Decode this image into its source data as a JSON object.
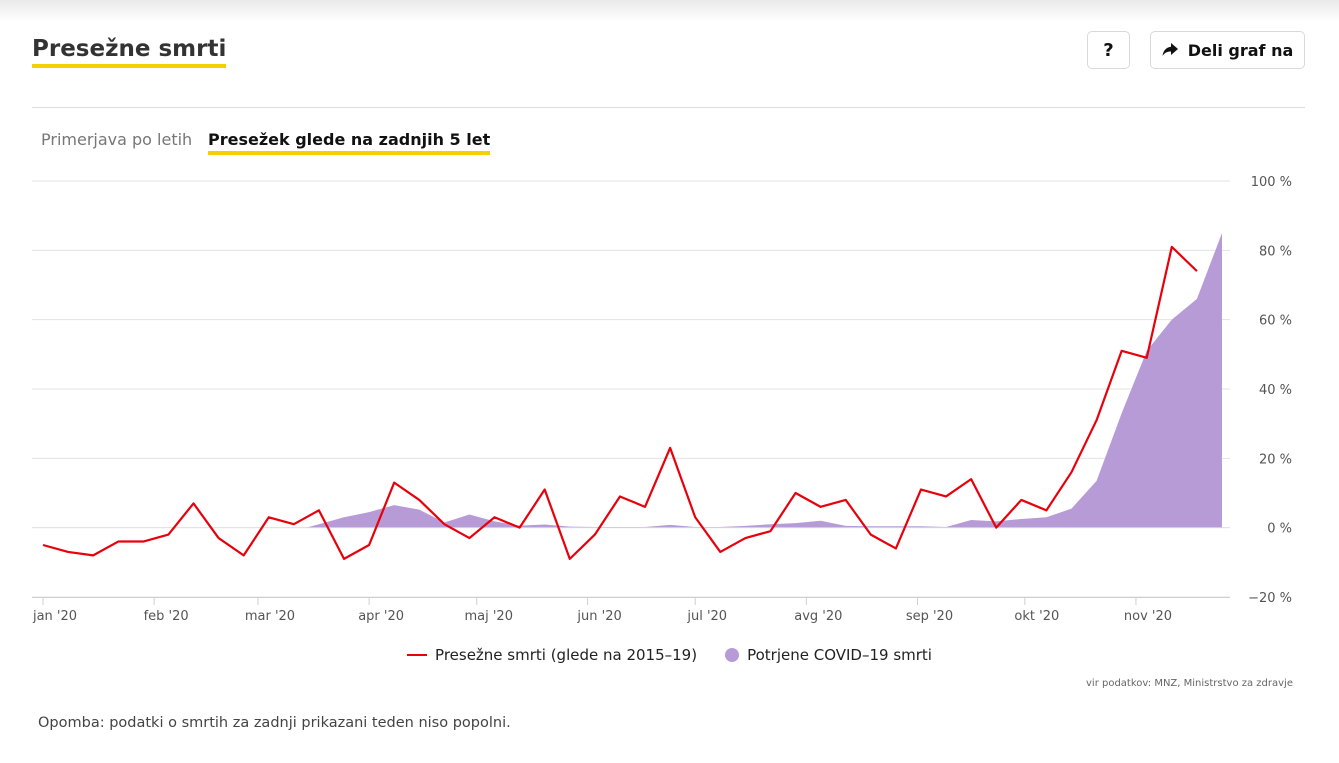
{
  "header": {
    "title": "Presežne smrti",
    "help_label": "?",
    "share_label": "Deli graf na"
  },
  "tabs": [
    {
      "label": "Primerjava po letih",
      "active": false
    },
    {
      "label": "Presežek glede na zadnjih 5 let",
      "active": true
    }
  ],
  "legend": {
    "line_label": "Presežne smrti (glede na 2015–19)",
    "area_label": "Potrjene COVID–19 smrti"
  },
  "source": "vir podatkov: MNZ, Ministrstvo za zdravje",
  "note": "Opomba: podatki o smrtih za zadnji prikazani teden niso popolni.",
  "colors": {
    "line": "#e8000b",
    "area": "#b79bd6",
    "accent": "#f5d000"
  },
  "chart_data": {
    "type": "line",
    "x_axis": {
      "type": "time",
      "ticks": [
        "jan '20",
        "feb '20",
        "mar '20",
        "apr '20",
        "maj '20",
        "jun '20",
        "jul '20",
        "avg '20",
        "sep '20",
        "okt '20",
        "nov '20"
      ]
    },
    "y_axis": {
      "ticks": [
        "100 %",
        "80 %",
        "60 %",
        "40 %",
        "20 %",
        "0 %",
        "−20 %"
      ],
      "ylim": [
        -20,
        100
      ],
      "position": "right",
      "grid": true
    },
    "x_weeks_range": [
      0,
      47
    ],
    "series": [
      {
        "name": "Presežne smrti (glede na 2015–19)",
        "type": "line",
        "x_weeks": [
          0,
          1,
          2,
          3,
          4,
          5,
          6,
          7,
          8,
          9,
          10,
          11,
          12,
          13,
          14,
          15,
          16,
          17,
          18,
          19,
          20,
          21,
          22,
          23,
          24,
          25,
          26,
          27,
          28,
          29,
          30,
          31,
          32,
          33,
          34,
          35,
          36,
          37,
          38,
          39,
          40,
          41,
          42,
          43,
          44,
          45,
          46
        ],
        "values": [
          -5,
          -7,
          -8,
          -4,
          -4,
          -2,
          7,
          -3,
          -8,
          3,
          1,
          5,
          -9,
          -5,
          13,
          8,
          1,
          -3,
          3,
          0,
          11,
          -9,
          -2,
          9,
          6,
          23,
          3,
          -7,
          -3,
          -1,
          10,
          6,
          8,
          -2,
          -6,
          11,
          9,
          14,
          0,
          8,
          5,
          16,
          31,
          51,
          49,
          81,
          74
        ]
      },
      {
        "name": "Potrjene COVID–19 smrti",
        "type": "area",
        "x_weeks": [
          10.5,
          11,
          12,
          13,
          14,
          15,
          16,
          17,
          18,
          19,
          20,
          21,
          22,
          23,
          24,
          25,
          26,
          27,
          28,
          29,
          30,
          31,
          32,
          33,
          34,
          35,
          36,
          37,
          38,
          39,
          40,
          41,
          42,
          43,
          44,
          45,
          46,
          47
        ],
        "values": [
          0,
          1,
          3,
          4.5,
          6.5,
          5.2,
          1.5,
          3.8,
          1.8,
          0.6,
          0.9,
          0.3,
          0.2,
          0.2,
          0.2,
          0.8,
          0.2,
          0.2,
          0.5,
          1,
          1.3,
          2,
          0.5,
          0.4,
          0.4,
          0.4,
          0.2,
          2.2,
          1.8,
          2.5,
          3,
          5.5,
          13.5,
          33,
          51,
          60,
          66,
          85
        ]
      }
    ]
  }
}
